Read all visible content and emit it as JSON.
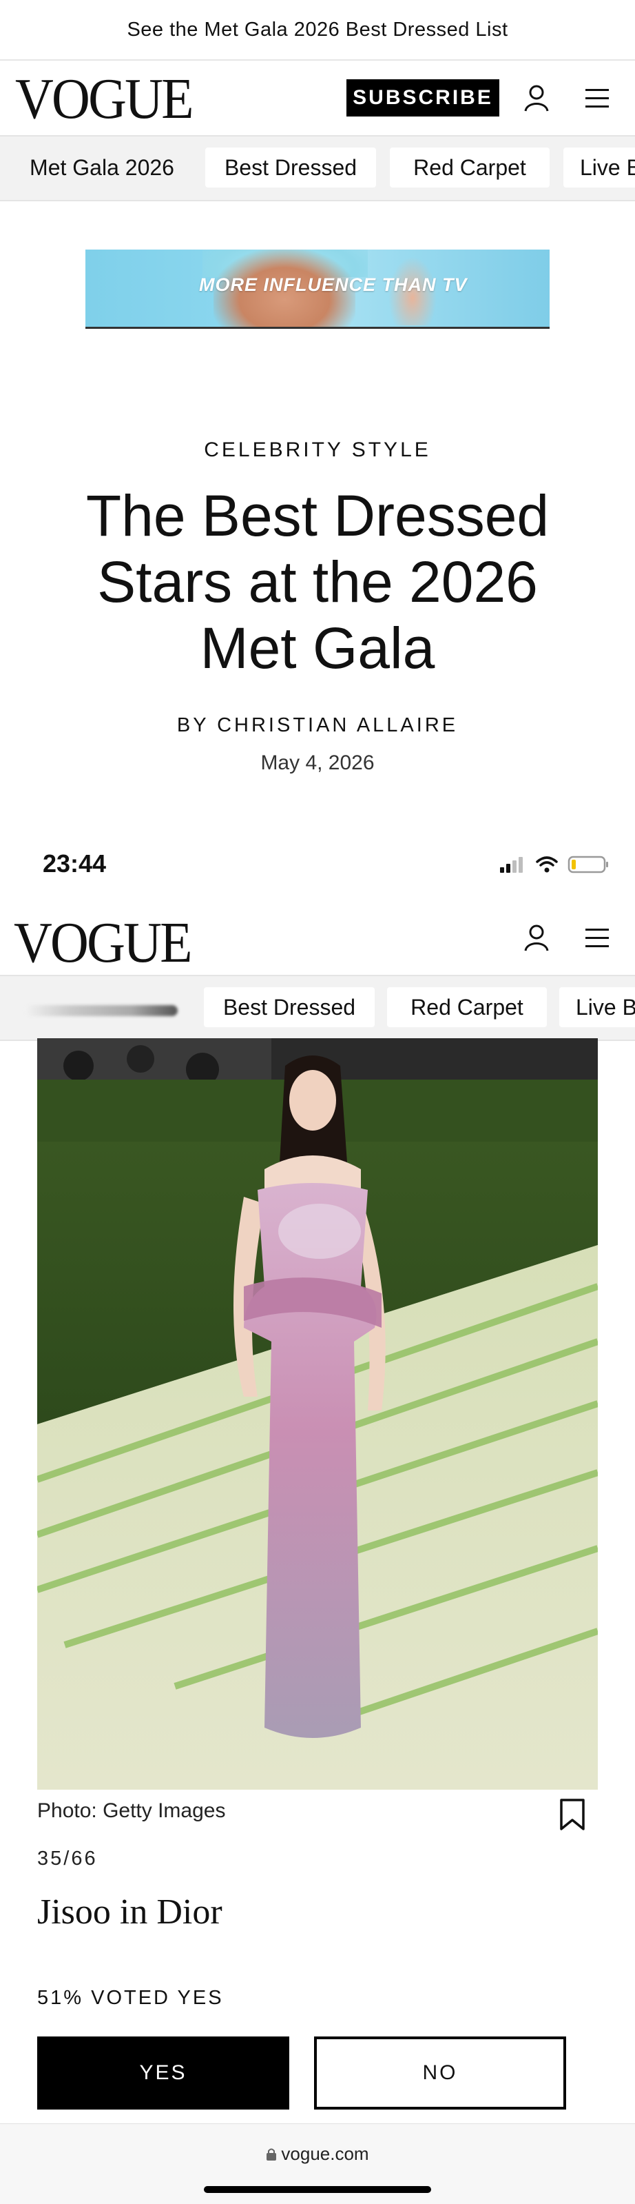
{
  "promo_bar": {
    "text": "See the Met Gala 2026 Best Dressed List"
  },
  "header": {
    "logo": "VOGUE",
    "subscribe_label": "SUBSCRIBE"
  },
  "tabs_top": [
    "Met Gala 2026",
    "Best Dressed",
    "Red Carpet",
    "Live B"
  ],
  "ad": {
    "headline": "MORE INFLUENCE THAN TV"
  },
  "article": {
    "kicker": "CELEBRITY STYLE",
    "headline": "The Best Dressed Stars at the 2026 Met Gala",
    "byline": "BY CHRISTIAN ALLAIRE",
    "date": "May 4, 2026"
  },
  "status_bar": {
    "time": "23:44"
  },
  "tabs_sticky": [
    "Best Dressed",
    "Red Carpet",
    "Live B"
  ],
  "slide": {
    "credit": "Photo: Getty Images",
    "counter": "35/66",
    "title": "Jisoo in Dior"
  },
  "poll": {
    "stat": "51% VOTED YES",
    "yes_label": "YES",
    "no_label": "NO"
  },
  "browser": {
    "url": "vogue.com"
  },
  "icons": {
    "user": "user-icon",
    "menu": "hamburger-menu-icon",
    "bookmark": "bookmark-icon",
    "lock": "lock-icon"
  },
  "colors": {
    "brand_black": "#000000",
    "tab_bg": "#f2f2f2"
  }
}
